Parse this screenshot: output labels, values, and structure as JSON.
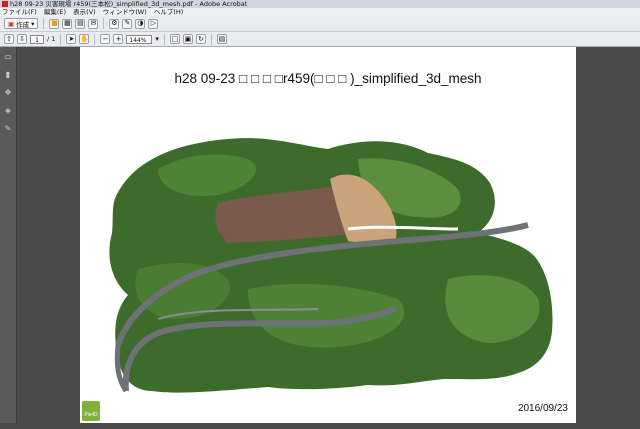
{
  "window": {
    "title": "h28 09-23 災害現場 r459(三本松)_simplified_3d_mesh.pdf - Adobe Acrobat"
  },
  "menu": [
    "ファイル(F)",
    "編集(E)",
    "表示(V)",
    "ウィンドウ(W)",
    "ヘルプ(H)"
  ],
  "toolbar": {
    "create_label": "作成",
    "page_current": "1",
    "page_total": "/ 1",
    "zoom_value": "144%"
  },
  "document": {
    "title": "h28  09-23  □ □ □ □r459(□ □ □ )_simplified_3d_mesh",
    "date": "2016/09/23",
    "logo_text": "Pix4D"
  },
  "colors": {
    "background": "#4b4b4b",
    "page": "#ffffff",
    "vegetation": "#3d6b2c",
    "road": "#6e7276",
    "landslide": "#c9a47a"
  }
}
